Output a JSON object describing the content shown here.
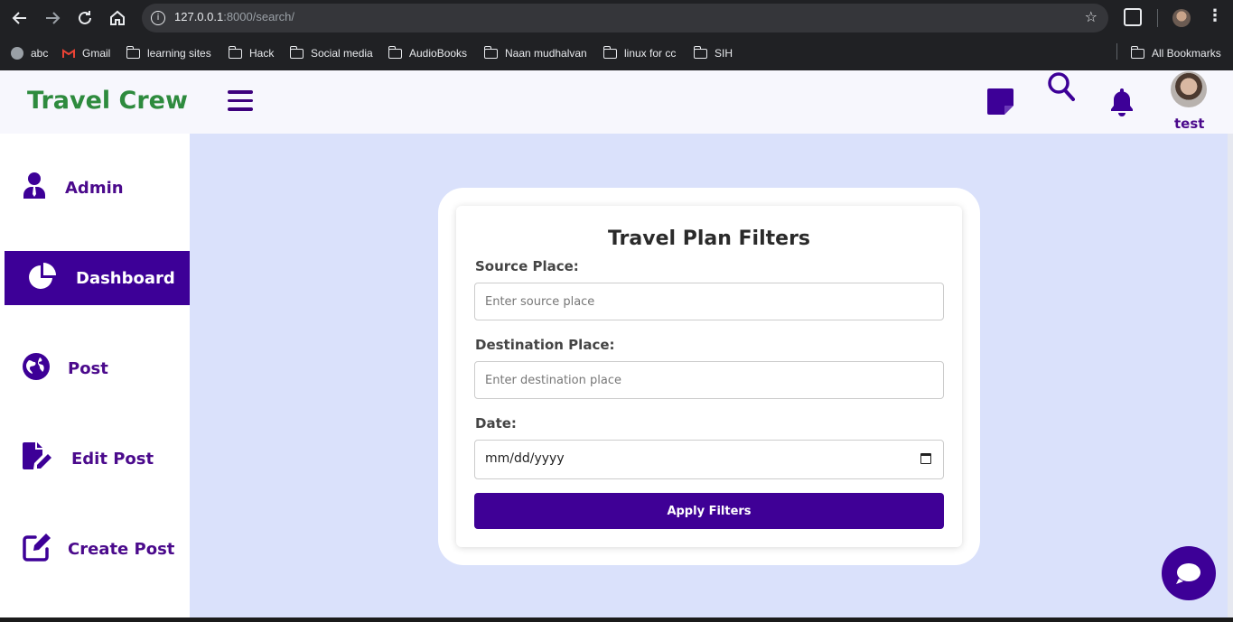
{
  "browser": {
    "url_host": "127.0.0.1",
    "url_rest": ":8000/search/",
    "bookmarks": [
      "abc",
      "Gmail",
      "learning sites",
      "Hack",
      "Social media",
      "AudioBooks",
      "Naan mudhalvan",
      "linux for cc",
      "SIH"
    ],
    "all_bookmarks": "All Bookmarks"
  },
  "header": {
    "brand": "Travel Crew",
    "user_name": "test",
    "brand_color": "#2e8b3e",
    "accent_color": "#3d0097"
  },
  "sidebar": {
    "items": [
      {
        "label": "Admin",
        "icon": "admin-user-icon",
        "active": false
      },
      {
        "label": "Dashboard",
        "icon": "pie-chart-icon",
        "active": true
      },
      {
        "label": "Post",
        "icon": "globe-icon",
        "active": false
      },
      {
        "label": "Edit Post",
        "icon": "file-edit-icon",
        "active": false
      },
      {
        "label": "Create Post",
        "icon": "pen-square-icon",
        "active": false
      }
    ]
  },
  "form": {
    "title": "Travel Plan Filters",
    "source_label": "Source Place:",
    "source_placeholder": "Enter source place",
    "destination_label": "Destination Place:",
    "destination_placeholder": "Enter destination place",
    "date_label": "Date:",
    "date_value": "mm/dd/yyyy",
    "submit_label": "Apply Filters"
  }
}
